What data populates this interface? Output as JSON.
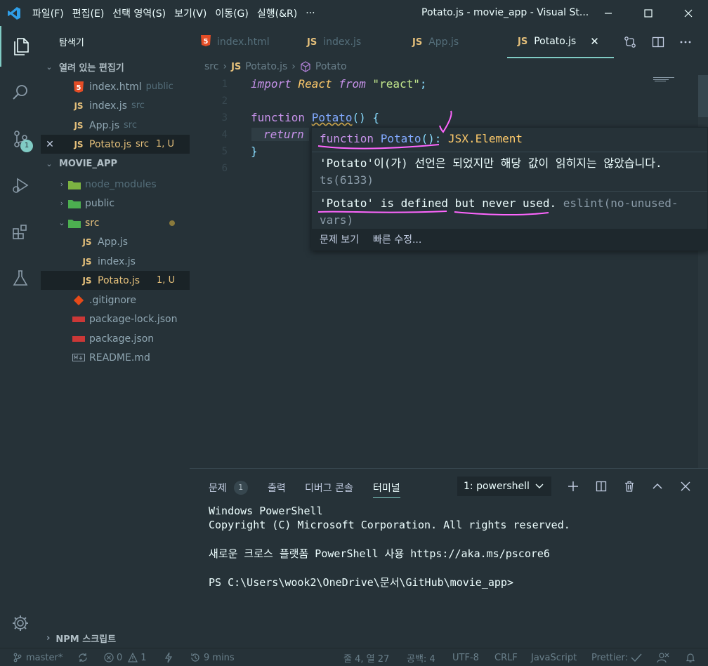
{
  "titlebar": {
    "menu": [
      "파일(F)",
      "편집(E)",
      "선택 영역(S)",
      "보기(V)",
      "이동(G)",
      "실행(&R)",
      "···"
    ],
    "window_title": "Potato.js - movie_app - Visual St..."
  },
  "sidebar": {
    "title": "탐색기",
    "open_editors_header": "열려 있는 편집기",
    "open_editors": [
      {
        "name": "index.html",
        "folder": "public",
        "icon": "html5-icon"
      },
      {
        "name": "index.js",
        "folder": "src",
        "icon": "js-icon"
      },
      {
        "name": "App.js",
        "folder": "src",
        "icon": "js-icon"
      },
      {
        "name": "Potato.js",
        "folder": "src",
        "status": "1, U",
        "icon": "js-icon"
      }
    ],
    "project_header": "MOVIE_APP",
    "tree": [
      {
        "name": "node_modules",
        "icon": "folder-node-icon"
      },
      {
        "name": "public",
        "icon": "folder-public-icon"
      },
      {
        "name": "src",
        "icon": "folder-src-icon"
      },
      {
        "name": "App.js",
        "icon": "js-icon"
      },
      {
        "name": "index.js",
        "icon": "js-icon"
      },
      {
        "name": "Potato.js",
        "status": "1, U",
        "icon": "js-icon"
      },
      {
        "name": ".gitignore",
        "icon": "git-icon"
      },
      {
        "name": "package-lock.json",
        "icon": "npm-icon"
      },
      {
        "name": "package.json",
        "icon": "npm-icon"
      },
      {
        "name": "README.md",
        "icon": "markdown-icon"
      }
    ],
    "npm_scripts": "NPM 스크립트"
  },
  "activity": {
    "scm_badge": "1"
  },
  "tabs": [
    {
      "label": "index.html",
      "icon": "html5-icon"
    },
    {
      "label": "index.js",
      "icon": "js-icon"
    },
    {
      "label": "App.js",
      "icon": "js-icon"
    },
    {
      "label": "Potato.js",
      "icon": "js-icon",
      "active": true
    }
  ],
  "js_label": "JS",
  "breadcrumb": {
    "folder": "src",
    "file": "Potato.js",
    "symbol": "Potato"
  },
  "editor": {
    "line_numbers": [
      "1",
      "2",
      "3",
      "4",
      "5",
      "6"
    ],
    "tokens": {
      "import": "import",
      "react_id": "React",
      "from": "from",
      "react_str": "\"react\"",
      "semi": ";",
      "function": "function",
      "potato": "Potato",
      "parens_brace": "() {",
      "return": "return",
      "close_brace": "}"
    }
  },
  "hover": {
    "sig_keyword": "function",
    "sig_name": "Potato",
    "sig_parens": "()",
    "sig_colon": ":",
    "sig_type": "JSX.Element",
    "message_ts": "'Potato'이(가) 선언은 되었지만 해당 값이 읽히지는 않았습니다.",
    "message_ts_code": "ts(6133)",
    "message_eslint": "'Potato' is defined but never used.",
    "message_eslint_code": "eslint(no-unused-vars)",
    "action_problem": "문제 보기",
    "action_fix": "빠른 수정..."
  },
  "panel": {
    "tabs": {
      "problems": "문제",
      "problems_count": "1",
      "output": "출력",
      "debug": "디버그 콘솔",
      "terminal": "터미널"
    },
    "terminal_select": "1: powershell",
    "lines": [
      "Windows PowerShell",
      "Copyright (C) Microsoft Corporation. All rights reserved.",
      "새로운 크로스 플랫폼 PowerShell 사용 https://aka.ms/pscore6",
      "PS C:\\Users\\wook2\\OneDrive\\문서\\GitHub\\movie_app>"
    ]
  },
  "statusbar": {
    "branch": "master*",
    "errors": "0",
    "warnings": "1",
    "time": "9 mins",
    "position": "줄 4, 열 27",
    "spaces": "공백: 4",
    "encoding": "UTF-8",
    "eol": "CRLF",
    "language": "JavaScript",
    "prettier": "Prettier:"
  },
  "colors": {
    "accent": "#80cbc4",
    "background": "#263238",
    "annotation": "#ff66ff"
  }
}
